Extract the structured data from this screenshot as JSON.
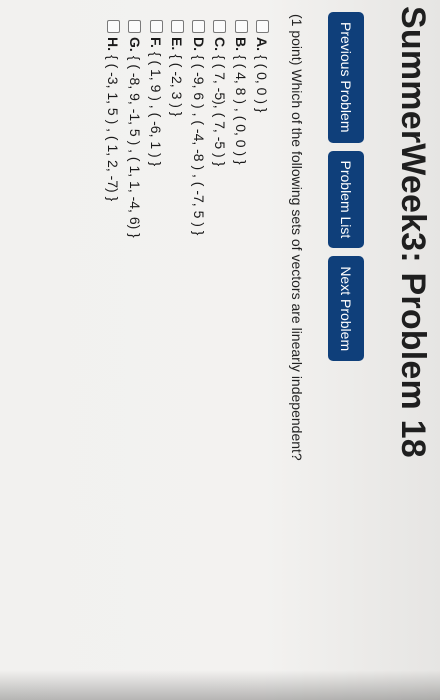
{
  "page": {
    "title": "SummerWeek3: Problem 18"
  },
  "nav": {
    "previous": "Previous Problem",
    "list": "Problem List",
    "next": "Next Problem"
  },
  "problem": {
    "prompt": "(1 point) Which of the following sets of vectors are linearly independent?",
    "options": [
      {
        "letter": "A.",
        "text": "{ ( 0, 0 ) }"
      },
      {
        "letter": "B.",
        "text": "{ ( 4, 8 ) , ( 0, 0 ) }"
      },
      {
        "letter": "C.",
        "text": "{ ( 7, -5), ( 7, -5 ) }"
      },
      {
        "letter": "D.",
        "text": "{ ( -9, 6 ) , ( -4, -8 ) , ( -7, 5 ) }"
      },
      {
        "letter": "E.",
        "text": "{ ( -2, 3 ) }"
      },
      {
        "letter": "F.",
        "text": "{ ( 1, 9 ) , ( -6, 1 ) }"
      },
      {
        "letter": "G.",
        "text": "{ ( -8, 9, -1, 5 ) , ( 1, 1, -4, 6) }"
      },
      {
        "letter": "H.",
        "text": "{ ( -3, 1, 5 ) , ( 1, 2, -7) }"
      }
    ]
  },
  "colors": {
    "nav_button_bg": "#0f3f7a",
    "nav_button_text": "#ffffff"
  }
}
